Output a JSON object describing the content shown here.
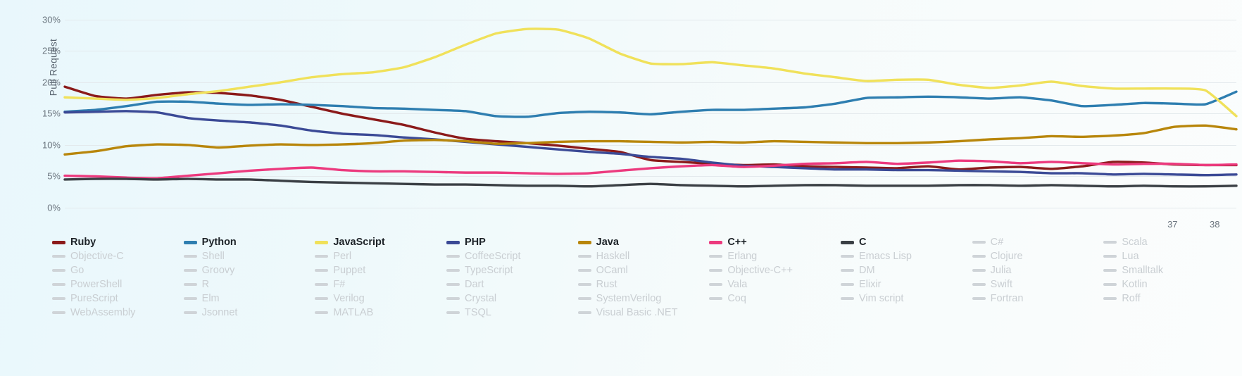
{
  "chart_data": {
    "type": "line",
    "title": "",
    "xlabel": "",
    "ylabel": "Pull Request",
    "ylim": [
      0,
      32
    ],
    "yticks": [
      "0%",
      "5%",
      "10%",
      "15%",
      "20%",
      "25%",
      "30%"
    ],
    "ytick_values": [
      0,
      5,
      10,
      15,
      20,
      25,
      30
    ],
    "xticks": [
      "37",
      "38"
    ],
    "xtick_positions": [
      0.9455,
      0.9815
    ],
    "grid": true,
    "legend_position": "bottom",
    "x": [
      0,
      1,
      2,
      3,
      4,
      5,
      6,
      7,
      8,
      9,
      10,
      11,
      12,
      13,
      14,
      15,
      16,
      17,
      18,
      19,
      20,
      21,
      22,
      23,
      24,
      25,
      26,
      27,
      28,
      29,
      30,
      31,
      32,
      33,
      34,
      35,
      36,
      37,
      38
    ],
    "series": [
      {
        "name": "Ruby",
        "color": "#8B1A1A",
        "active": true,
        "values": [
          19.3,
          17.8,
          17.4,
          18.0,
          18.4,
          18.3,
          17.9,
          17.2,
          16.1,
          15.0,
          14.1,
          13.2,
          12.0,
          11.0,
          10.6,
          10.3,
          9.9,
          9.4,
          8.9,
          7.6,
          7.3,
          7.0,
          6.8,
          6.9,
          6.6,
          6.5,
          6.4,
          6.3,
          6.6,
          6.1,
          6.4,
          6.5,
          6.2,
          6.6,
          7.3,
          7.2,
          6.9,
          6.8,
          6.8
        ]
      },
      {
        "name": "Python",
        "color": "#2E7EB0",
        "active": true,
        "values": [
          15.3,
          15.6,
          16.2,
          16.9,
          16.9,
          16.6,
          16.4,
          16.5,
          16.4,
          16.2,
          15.9,
          15.8,
          15.6,
          15.4,
          14.6,
          14.5,
          15.1,
          15.3,
          15.2,
          14.9,
          15.3,
          15.6,
          15.6,
          15.8,
          16.0,
          16.6,
          17.5,
          17.6,
          17.7,
          17.6,
          17.4,
          17.6,
          17.1,
          16.2,
          16.4,
          16.7,
          16.6,
          16.5,
          18.5
        ]
      },
      {
        "name": "JavaScript",
        "color": "#F0E15A",
        "active": true,
        "values": [
          17.6,
          17.4,
          17.2,
          17.5,
          18.1,
          18.6,
          19.3,
          20.0,
          20.8,
          21.3,
          21.6,
          22.4,
          24.0,
          26.0,
          27.8,
          28.5,
          28.4,
          27.0,
          24.6,
          23.0,
          22.9,
          23.2,
          22.7,
          22.2,
          21.4,
          20.8,
          20.2,
          20.4,
          20.4,
          19.6,
          19.1,
          19.5,
          20.1,
          19.4,
          19.0,
          19.0,
          19.0,
          18.7,
          14.6
        ]
      },
      {
        "name": "PHP",
        "color": "#3B4A96",
        "active": true,
        "values": [
          15.2,
          15.3,
          15.4,
          15.2,
          14.3,
          13.9,
          13.6,
          13.1,
          12.3,
          11.8,
          11.6,
          11.2,
          10.9,
          10.5,
          10.1,
          9.7,
          9.3,
          8.9,
          8.6,
          8.1,
          7.8,
          7.2,
          6.7,
          6.5,
          6.3,
          6.1,
          6.1,
          6.0,
          6.0,
          5.9,
          5.8,
          5.7,
          5.5,
          5.5,
          5.3,
          5.4,
          5.3,
          5.2,
          5.3
        ]
      },
      {
        "name": "Java",
        "color": "#B8860B",
        "active": true,
        "values": [
          8.5,
          9.0,
          9.8,
          10.1,
          10.0,
          9.6,
          9.9,
          10.1,
          10.0,
          10.1,
          10.3,
          10.7,
          10.8,
          10.6,
          10.2,
          10.3,
          10.5,
          10.6,
          10.6,
          10.5,
          10.4,
          10.5,
          10.4,
          10.6,
          10.5,
          10.4,
          10.3,
          10.3,
          10.4,
          10.6,
          10.9,
          11.1,
          11.4,
          11.3,
          11.5,
          11.9,
          12.9,
          13.1,
          12.5
        ]
      },
      {
        "name": "C++",
        "color": "#EC3A7E",
        "active": true,
        "values": [
          5.1,
          5.0,
          4.8,
          4.7,
          5.1,
          5.5,
          5.9,
          6.2,
          6.4,
          6.0,
          5.8,
          5.8,
          5.7,
          5.6,
          5.6,
          5.5,
          5.4,
          5.5,
          5.9,
          6.3,
          6.6,
          6.8,
          6.5,
          6.7,
          7.0,
          7.1,
          7.3,
          7.0,
          7.2,
          7.5,
          7.4,
          7.1,
          7.3,
          7.1,
          6.9,
          7.0,
          7.0,
          6.8,
          6.9
        ]
      },
      {
        "name": "C",
        "color": "#3A3F44",
        "active": true,
        "values": [
          4.5,
          4.6,
          4.6,
          4.5,
          4.6,
          4.5,
          4.5,
          4.3,
          4.1,
          4.0,
          3.9,
          3.8,
          3.7,
          3.7,
          3.6,
          3.5,
          3.5,
          3.4,
          3.6,
          3.8,
          3.6,
          3.5,
          3.4,
          3.5,
          3.6,
          3.6,
          3.5,
          3.5,
          3.5,
          3.6,
          3.6,
          3.5,
          3.6,
          3.5,
          3.4,
          3.5,
          3.4,
          3.4,
          3.5
        ]
      }
    ],
    "inactive_color": "#CFD4D8",
    "inactive_legend": [
      [
        "Objective-C",
        "Go",
        "PowerShell",
        "PureScript",
        "WebAssembly"
      ],
      [
        "Shell",
        "Groovy",
        "R",
        "Elm",
        "Jsonnet"
      ],
      [
        "Perl",
        "Puppet",
        "F#",
        "Verilog",
        "MATLAB"
      ],
      [
        "CoffeeScript",
        "TypeScript",
        "Dart",
        "Crystal",
        "TSQL"
      ],
      [
        "Haskell",
        "OCaml",
        "Rust",
        "SystemVerilog",
        "Visual Basic .NET"
      ],
      [
        "Erlang",
        "Objective-C++",
        "Vala",
        "Coq"
      ],
      [
        "Emacs Lisp",
        "DM",
        "Elixir",
        "Vim script"
      ],
      [
        "Clojure",
        "Julia",
        "Swift",
        "Fortran"
      ],
      [
        "Lua",
        "Smalltalk",
        "Kotlin",
        "Roff"
      ]
    ],
    "extra_legend_heads": [
      "C#",
      "Scala"
    ]
  },
  "legend": {
    "columns": [
      {
        "head": {
          "label": "Ruby",
          "color": "#8B1A1A",
          "active": true
        },
        "items": [
          "Objective-C",
          "Go",
          "PowerShell",
          "PureScript",
          "WebAssembly"
        ]
      },
      {
        "head": {
          "label": "Python",
          "color": "#2E7EB0",
          "active": true
        },
        "items": [
          "Shell",
          "Groovy",
          "R",
          "Elm",
          "Jsonnet"
        ]
      },
      {
        "head": {
          "label": "JavaScript",
          "color": "#F0E15A",
          "active": true
        },
        "items": [
          "Perl",
          "Puppet",
          "F#",
          "Verilog",
          "MATLAB"
        ]
      },
      {
        "head": {
          "label": "PHP",
          "color": "#3B4A96",
          "active": true
        },
        "items": [
          "CoffeeScript",
          "TypeScript",
          "Dart",
          "Crystal",
          "TSQL"
        ]
      },
      {
        "head": {
          "label": "Java",
          "color": "#B8860B",
          "active": true
        },
        "items": [
          "Haskell",
          "OCaml",
          "Rust",
          "SystemVerilog",
          "Visual Basic .NET"
        ]
      },
      {
        "head": {
          "label": "C++",
          "color": "#EC3A7E",
          "active": true
        },
        "items": [
          "Erlang",
          "Objective-C++",
          "Vala",
          "Coq"
        ]
      },
      {
        "head": {
          "label": "C",
          "color": "#3A3F44",
          "active": true
        },
        "items": [
          "Emacs Lisp",
          "DM",
          "Elixir",
          "Vim script"
        ]
      },
      {
        "head": {
          "label": "C#",
          "color": "#CFD4D8",
          "active": false
        },
        "items": [
          "Clojure",
          "Julia",
          "Swift",
          "Fortran"
        ]
      },
      {
        "head": {
          "label": "Scala",
          "color": "#CFD4D8",
          "active": false
        },
        "items": [
          "Lua",
          "Smalltalk",
          "Kotlin",
          "Roff"
        ]
      }
    ]
  }
}
